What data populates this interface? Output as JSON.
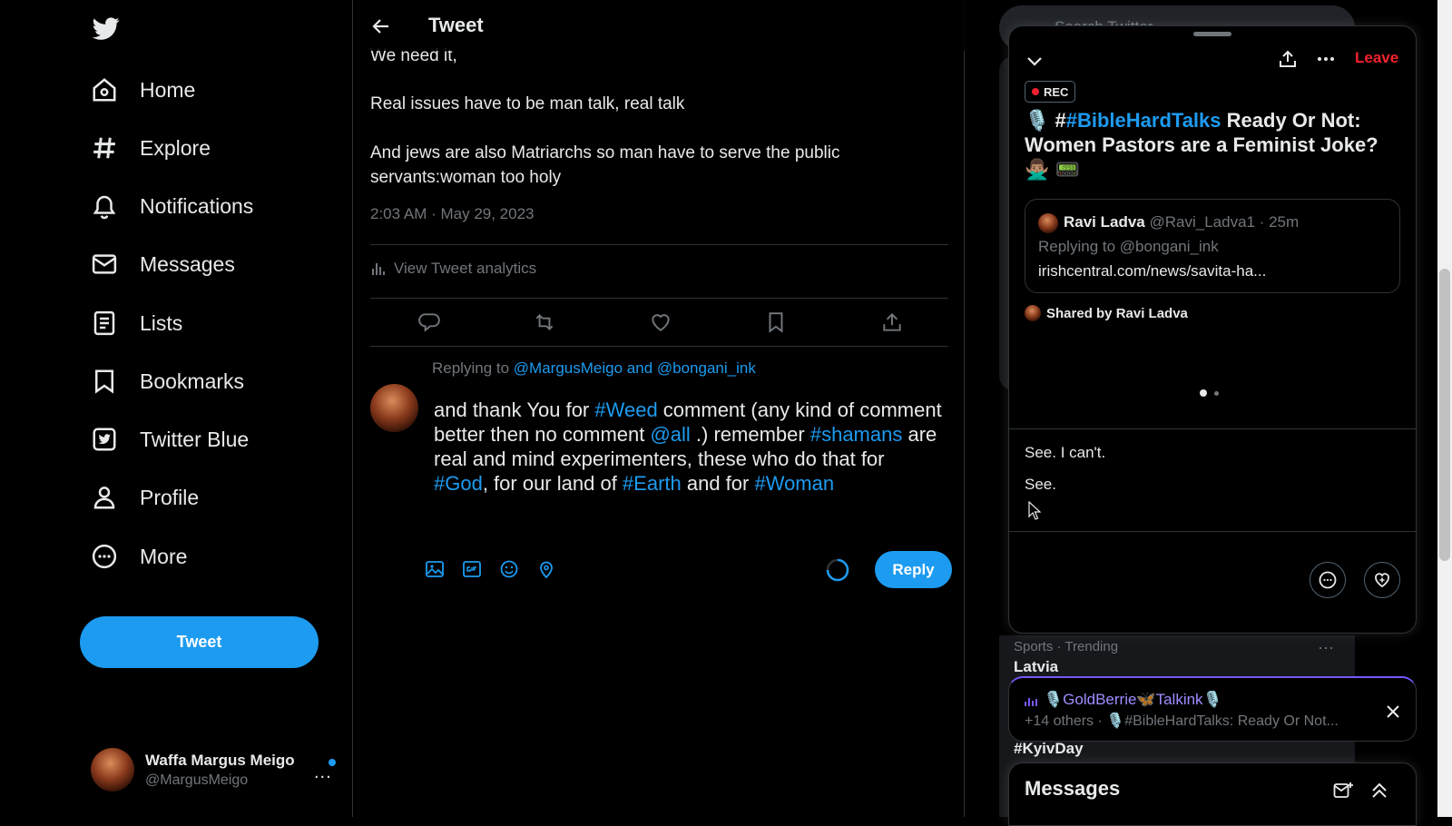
{
  "nav": {
    "items": [
      {
        "label": "Home",
        "icon": "home-icon"
      },
      {
        "label": "Explore",
        "icon": "hash-icon"
      },
      {
        "label": "Notifications",
        "icon": "bell-icon"
      },
      {
        "label": "Messages",
        "icon": "envelope-icon"
      },
      {
        "label": "Lists",
        "icon": "list-icon"
      },
      {
        "label": "Bookmarks",
        "icon": "bookmark-icon"
      },
      {
        "label": "Twitter Blue",
        "icon": "twitter-blue-icon"
      },
      {
        "label": "Profile",
        "icon": "person-icon"
      },
      {
        "label": "More",
        "icon": "more-circle-icon"
      }
    ],
    "tweet_button": "Tweet"
  },
  "account": {
    "name": "Waffa Margus Meigo",
    "handle": "@MargusMeigo",
    "more": "..."
  },
  "header": {
    "title": "Tweet"
  },
  "tweet": {
    "line1": "We need it,",
    "line2": "Real issues have to be man talk, real talk",
    "line3": "And jews are also Matriarchs so man have to serve the public servants:woman too holy",
    "timestamp": "2:03 AM · May 29, 2023",
    "analytics": "View Tweet analytics"
  },
  "reply": {
    "replying_prefix": "Replying to",
    "mention1": "@MargusMeigo",
    "and": "and",
    "mention2": "@bongani_ink",
    "segments": {
      "s1": "and thank You for ",
      "h1": "#Weed",
      "s2": " comment (any kind of comment better then no comment ",
      "h2": "@all",
      "s3": " .) remember ",
      "h3": "#shamans",
      "s4": " are real and mind experimenters, these who do that for ",
      "h4": "#God",
      "s5": ", for our land of ",
      "h5": "#Earth",
      "s6": " and for ",
      "h6": "#Woman"
    },
    "button": "Reply"
  },
  "search": {
    "placeholder": "Search Twitter"
  },
  "space": {
    "leave": "Leave",
    "rec": "REC",
    "title_prefix": "🎙️ #",
    "title_tag": "#BibleHardTalks",
    "title_rest": " Ready Or Not: Women Pastors are a Feminist Joke? 🙅🏽‍♂️ 📟",
    "quoted": {
      "name": "Ravi Ladva",
      "meta": "@Ravi_Ladva1 · 25m",
      "replying": "Replying to @bongani_ink",
      "link": "irishcentral.com/news/savita-ha..."
    },
    "shared_by": "Shared by Ravi Ladva",
    "captions": [
      "See. I can't.",
      "See."
    ]
  },
  "trends": {
    "meta": "Sports · Trending",
    "name": "Latvia",
    "more": "···",
    "second": "#KyivDay"
  },
  "mini_space": {
    "host": "🎙️GoldBerrie🦋Talkink🎙️",
    "subtitle": "+14 others · 🎙️#BibleHardTalks: Ready Or Not..."
  },
  "messages": {
    "title": "Messages"
  },
  "colors": {
    "accent": "#1d9bf0",
    "leave": "#f4212e",
    "space_purple": "#7856ff"
  }
}
